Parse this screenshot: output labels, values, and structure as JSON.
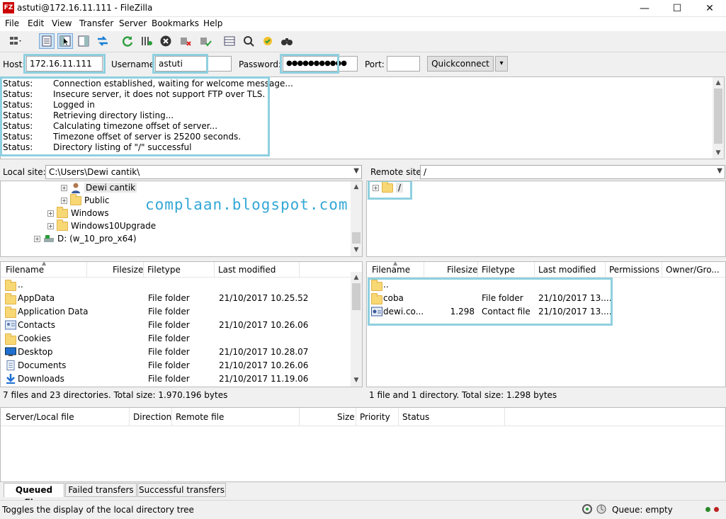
{
  "window": {
    "title": "astuti@172.16.11.111 - FileZilla",
    "app_icon_text": "FZ",
    "minimize": "—",
    "maximize": "☐",
    "close": "✕"
  },
  "menu": [
    "File",
    "Edit",
    "View",
    "Transfer",
    "Server",
    "Bookmarks",
    "Help"
  ],
  "quickconnect": {
    "host_label": "Host:",
    "host_value": "172.16.11.111",
    "username_label": "Username:",
    "username_value": "astuti",
    "password_label": "Password:",
    "password_value": "●●●●●●●●●●●",
    "port_label": "Port:",
    "port_value": "",
    "button_label": "Quickconnect",
    "dropdown": "▾"
  },
  "log": [
    {
      "k": "Status:",
      "v": "Connection established, waiting for welcome message..."
    },
    {
      "k": "Status:",
      "v": "Insecure server, it does not support FTP over TLS."
    },
    {
      "k": "Status:",
      "v": "Logged in"
    },
    {
      "k": "Status:",
      "v": "Retrieving directory listing..."
    },
    {
      "k": "Status:",
      "v": "Calculating timezone offset of server..."
    },
    {
      "k": "Status:",
      "v": "Timezone offset of server is 25200 seconds."
    },
    {
      "k": "Status:",
      "v": "Directory listing of \"/\" successful"
    }
  ],
  "local": {
    "site_label": "Local site:",
    "path": "C:\\Users\\Dewi cantik\\",
    "tree": [
      {
        "label": "Dewi cantik",
        "icon": "user-icon"
      },
      {
        "label": "Public",
        "icon": "folder-icon"
      },
      {
        "label": "Windows",
        "icon": "folder-icon"
      },
      {
        "label": "Windows10Upgrade",
        "icon": "folder-icon"
      },
      {
        "label": "D: (w_10_pro_x64)",
        "icon": "drive-icon"
      }
    ],
    "columns": [
      "Filename",
      "Filesize",
      "Filetype",
      "Last modified"
    ],
    "files": [
      {
        "name": "..",
        "size": "",
        "type": "",
        "modified": "",
        "icon": "folder-icon"
      },
      {
        "name": "AppData",
        "size": "",
        "type": "File folder",
        "modified": "21/10/2017 10.25.52",
        "icon": "folder-icon"
      },
      {
        "name": "Application Data",
        "size": "",
        "type": "File folder",
        "modified": "",
        "icon": "folder-icon"
      },
      {
        "name": "Contacts",
        "size": "",
        "type": "File folder",
        "modified": "21/10/2017 10.26.06",
        "icon": "contacts-icon"
      },
      {
        "name": "Cookies",
        "size": "",
        "type": "File folder",
        "modified": "",
        "icon": "folder-icon"
      },
      {
        "name": "Desktop",
        "size": "",
        "type": "File folder",
        "modified": "21/10/2017 10.28.07",
        "icon": "desktop-icon"
      },
      {
        "name": "Documents",
        "size": "",
        "type": "File folder",
        "modified": "21/10/2017 10.26.06",
        "icon": "documents-icon"
      },
      {
        "name": "Downloads",
        "size": "",
        "type": "File folder",
        "modified": "21/10/2017 11.19.06",
        "icon": "download-icon"
      }
    ],
    "status": "7 files and 23 directories. Total size: 1.970.196 bytes"
  },
  "remote": {
    "site_label": "Remote site:",
    "path": "/",
    "tree": [
      {
        "label": "/",
        "icon": "folder-icon"
      }
    ],
    "columns": [
      "Filename",
      "Filesize",
      "Filetype",
      "Last modified",
      "Permissions",
      "Owner/Gro..."
    ],
    "files": [
      {
        "name": "..",
        "size": "",
        "type": "",
        "modified": "",
        "icon": "folder-icon"
      },
      {
        "name": "coba",
        "size": "",
        "type": "File folder",
        "modified": "21/10/2017 13....",
        "icon": "folder-icon"
      },
      {
        "name": "dewi.co...",
        "size": "1.298",
        "type": "Contact file",
        "modified": "21/10/2017 13....",
        "icon": "contact-file-icon"
      }
    ],
    "status": "1 file and 1 directory. Total size: 1.298 bytes"
  },
  "queue": {
    "columns": [
      "Server/Local file",
      "Direction",
      "Remote file",
      "Size",
      "Priority",
      "Status"
    ],
    "tabs": [
      "Queued files",
      "Failed transfers",
      "Successful transfers"
    ]
  },
  "statusbar": {
    "text": "Toggles the display of the local directory tree",
    "queue": "Queue: empty"
  },
  "watermark": "complaan.blogspot.com",
  "colors": {
    "highlight": "#8fd0e0",
    "watermark": "#33a7d6",
    "folder": "#f8d775"
  }
}
